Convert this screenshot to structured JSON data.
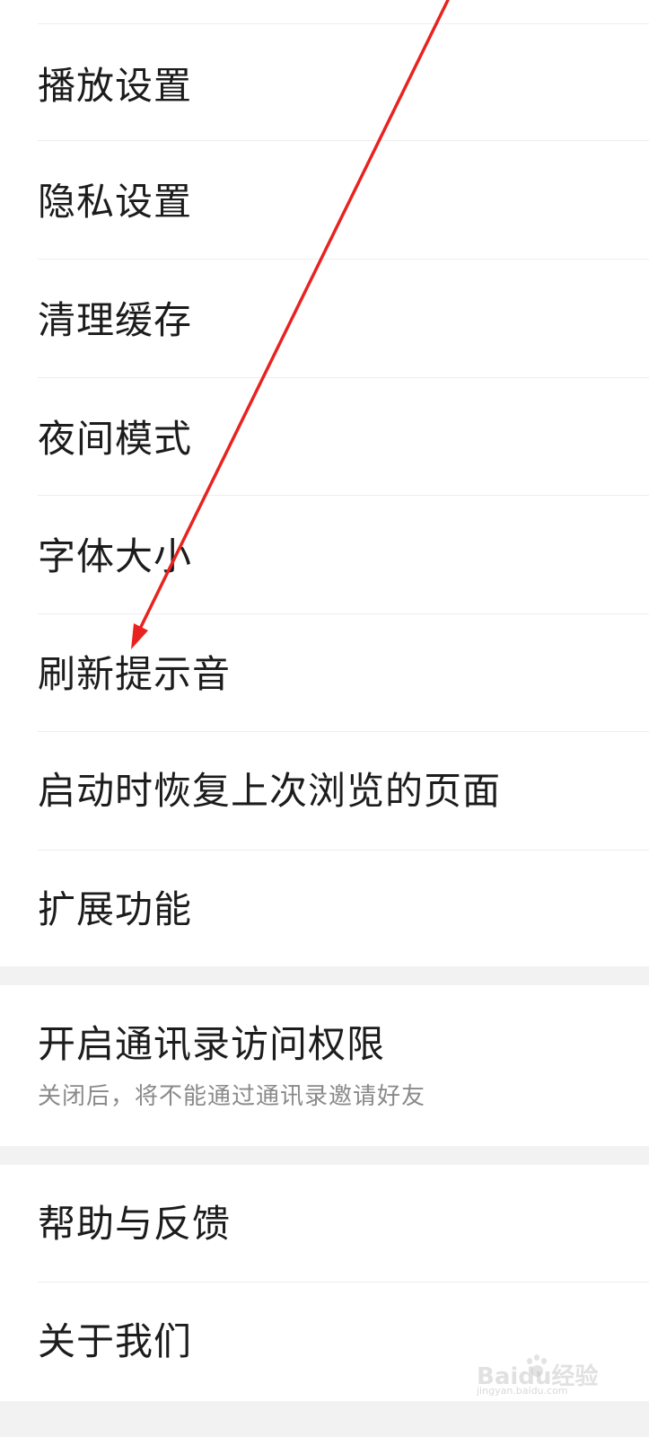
{
  "settings_group_1": {
    "items": [
      {
        "label": "播放设置"
      },
      {
        "label": "隐私设置"
      },
      {
        "label": "清理缓存"
      },
      {
        "label": "夜间模式"
      },
      {
        "label": "字体大小"
      },
      {
        "label": "刷新提示音"
      },
      {
        "label": "启动时恢复上次浏览的页面"
      },
      {
        "label": "扩展功能"
      }
    ]
  },
  "settings_group_2": {
    "contacts_permission": {
      "label": "开启通讯录访问权限",
      "description": "关闭后，将不能通过通讯录邀请好友"
    }
  },
  "settings_group_3": {
    "items": [
      {
        "label": "帮助与反馈"
      },
      {
        "label": "关于我们"
      }
    ]
  },
  "annotation": {
    "arrow_color": "#e8231f"
  },
  "watermark": {
    "text": "Baidu经验",
    "sub_text": "jingyan.baidu.com"
  },
  "colors": {
    "background": "#f2f2f2",
    "card": "#ffffff",
    "text_primary": "#1c1c1c",
    "text_secondary": "#8a8a8a",
    "divider": "#ededed"
  }
}
